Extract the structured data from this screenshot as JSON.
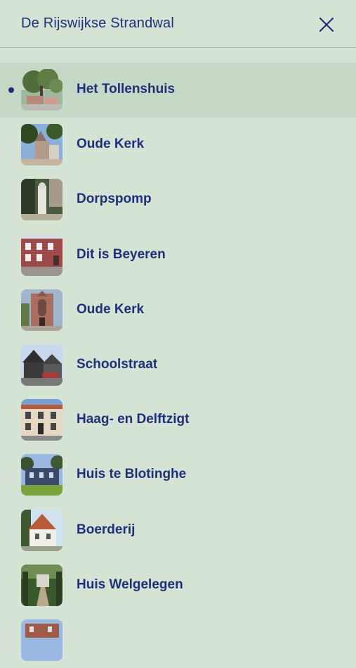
{
  "header": {
    "title": "De Rijswijkse Strandwal",
    "close_icon": "close-icon"
  },
  "colors": {
    "background": "#d4e3d4",
    "active_row": "#c6d8c6",
    "text": "#1f2f7a",
    "divider": "#a9bcae"
  },
  "list": {
    "items": [
      {
        "label": "Het Tollenshuis",
        "active": true,
        "thumb": "tree-house-photo"
      },
      {
        "label": "Oude Kerk",
        "active": false,
        "thumb": "church-trees-photo"
      },
      {
        "label": "Dorpspomp",
        "active": false,
        "thumb": "pump-statue-photo"
      },
      {
        "label": "Dit is Beyeren",
        "active": false,
        "thumb": "brick-street-photo"
      },
      {
        "label": "Oude Kerk",
        "active": false,
        "thumb": "church-tower-photo"
      },
      {
        "label": "Schoolstraat",
        "active": false,
        "thumb": "dark-house-photo"
      },
      {
        "label": "Haag- en Delftzigt",
        "active": false,
        "thumb": "townhouse-photo"
      },
      {
        "label": "Huis te Blotinghe",
        "active": false,
        "thumb": "villa-lawn-photo"
      },
      {
        "label": "Boerderij",
        "active": false,
        "thumb": "farmhouse-photo"
      },
      {
        "label": "Huis Welgelegen",
        "active": false,
        "thumb": "mansion-lane-photo"
      },
      {
        "label": "",
        "active": false,
        "thumb": "partial-photo"
      }
    ]
  }
}
